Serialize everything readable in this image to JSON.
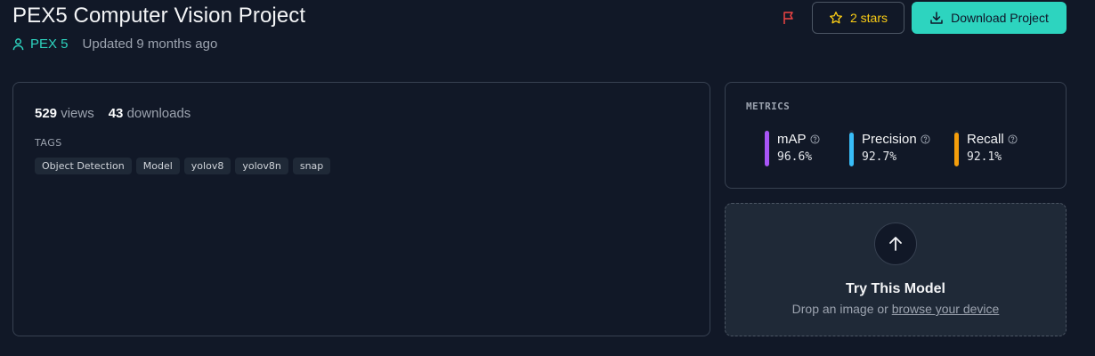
{
  "header": {
    "title": "PEX5 Computer Vision Project",
    "owner": "PEX 5",
    "updated": "Updated 9 months ago",
    "stars_label": "2 stars",
    "download_label": "Download Project"
  },
  "stats": {
    "views_count": "529",
    "views_label": "views",
    "downloads_count": "43",
    "downloads_label": "downloads"
  },
  "tags": {
    "heading": "TAGS",
    "items": [
      "Object Detection",
      "Model",
      "yolov8",
      "yolov8n",
      "snap"
    ]
  },
  "metrics": {
    "heading": "METRICS",
    "items": [
      {
        "name": "mAP",
        "value": "96.6%",
        "fraction": 0.966,
        "color": "#a855f7"
      },
      {
        "name": "Precision",
        "value": "92.7%",
        "fraction": 0.927,
        "color": "#38bdf8"
      },
      {
        "name": "Recall",
        "value": "92.1%",
        "fraction": 0.921,
        "color": "#f59e0b"
      }
    ]
  },
  "try_model": {
    "title": "Try This Model",
    "prefix": "Drop an image or ",
    "link": "browse your device"
  },
  "colors": {
    "accent": "#2dd4bf",
    "star": "#facc15",
    "flag": "#ef4444",
    "background": "#111827"
  },
  "icons": {
    "owner": "user-icon",
    "flag": "flag-icon",
    "star": "star-icon",
    "download": "download-icon",
    "help": "help-circle-icon",
    "upload": "arrow-up-icon"
  }
}
